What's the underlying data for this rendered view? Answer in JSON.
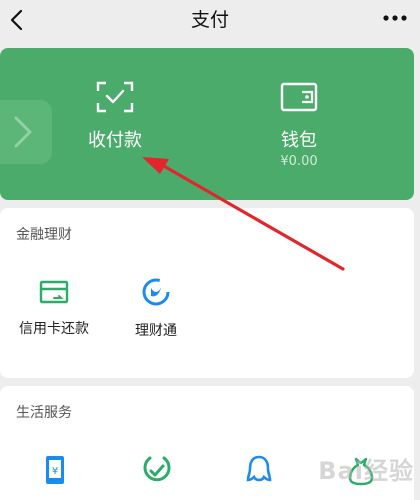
{
  "header": {
    "title": "支付"
  },
  "main_card": {
    "shoufukuan_label": "收付款",
    "wallet_label": "钱包",
    "wallet_balance": "¥0.00"
  },
  "sections": {
    "finance": {
      "title": "金融理财",
      "items": [
        {
          "label": "信用卡还款",
          "icon": "credit-card-repay-icon"
        },
        {
          "label": "理财通",
          "icon": "licaitong-icon"
        }
      ]
    },
    "life": {
      "title": "生活服务",
      "items": [
        {
          "label": "",
          "icon": "phone-recharge-icon"
        },
        {
          "label": "",
          "icon": "checkmark-service-icon"
        },
        {
          "label": "",
          "icon": "qq-service-icon"
        },
        {
          "label": "",
          "icon": "money-bag-icon"
        }
      ]
    }
  },
  "watermark": "Bai经验",
  "colors": {
    "card_green": "#4bab6a",
    "background": "#ededed",
    "arrow_red": "#e3262c",
    "icon_blue": "#1a8cf0",
    "icon_green": "#2aae67"
  }
}
